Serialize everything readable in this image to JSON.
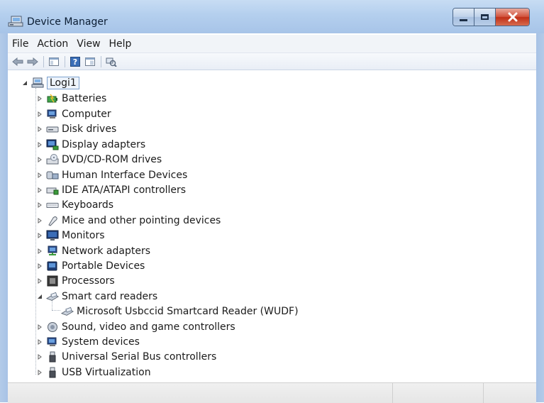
{
  "window": {
    "title": "Device Manager"
  },
  "menubar": {
    "items": [
      "File",
      "Action",
      "View",
      "Help"
    ]
  },
  "toolbar": {
    "buttons": [
      "back-icon",
      "forward-icon",
      "show-hide-console-tree-icon",
      "help-icon",
      "properties-icon",
      "scan-hardware-icon"
    ]
  },
  "tree": {
    "root": {
      "label": "Logi1",
      "icon": "computer-icon",
      "expanded": true
    },
    "categories": [
      {
        "label": "Batteries",
        "icon": "battery-icon",
        "expanded": false
      },
      {
        "label": "Computer",
        "icon": "computer-icon",
        "expanded": false
      },
      {
        "label": "Disk drives",
        "icon": "disk-drive-icon",
        "expanded": false
      },
      {
        "label": "Display adapters",
        "icon": "display-adapter-icon",
        "expanded": false
      },
      {
        "label": "DVD/CD-ROM drives",
        "icon": "dvd-drive-icon",
        "expanded": false
      },
      {
        "label": "Human Interface Devices",
        "icon": "hid-icon",
        "expanded": false
      },
      {
        "label": "IDE ATA/ATAPI controllers",
        "icon": "ide-controller-icon",
        "expanded": false
      },
      {
        "label": "Keyboards",
        "icon": "keyboard-icon",
        "expanded": false
      },
      {
        "label": "Mice and other pointing devices",
        "icon": "mouse-icon",
        "expanded": false
      },
      {
        "label": "Monitors",
        "icon": "monitor-icon",
        "expanded": false
      },
      {
        "label": "Network adapters",
        "icon": "network-adapter-icon",
        "expanded": false
      },
      {
        "label": "Portable Devices",
        "icon": "portable-device-icon",
        "expanded": false
      },
      {
        "label": "Processors",
        "icon": "processor-icon",
        "expanded": false
      },
      {
        "label": "Smart card readers",
        "icon": "smart-card-reader-icon",
        "expanded": true,
        "children": [
          {
            "label": "Microsoft Usbccid Smartcard Reader (WUDF)",
            "icon": "smart-card-reader-icon"
          }
        ]
      },
      {
        "label": "Sound, video and game controllers",
        "icon": "sound-icon",
        "expanded": false
      },
      {
        "label": "System devices",
        "icon": "system-devices-icon",
        "expanded": false
      },
      {
        "label": "Universal Serial Bus controllers",
        "icon": "usb-icon",
        "expanded": false
      },
      {
        "label": "USB Virtualization",
        "icon": "usb-icon",
        "expanded": false
      }
    ]
  },
  "colors": {
    "titlebar": "#b4cfee",
    "close_button": "#c8412b",
    "selection_outline": "#7da2ce"
  }
}
